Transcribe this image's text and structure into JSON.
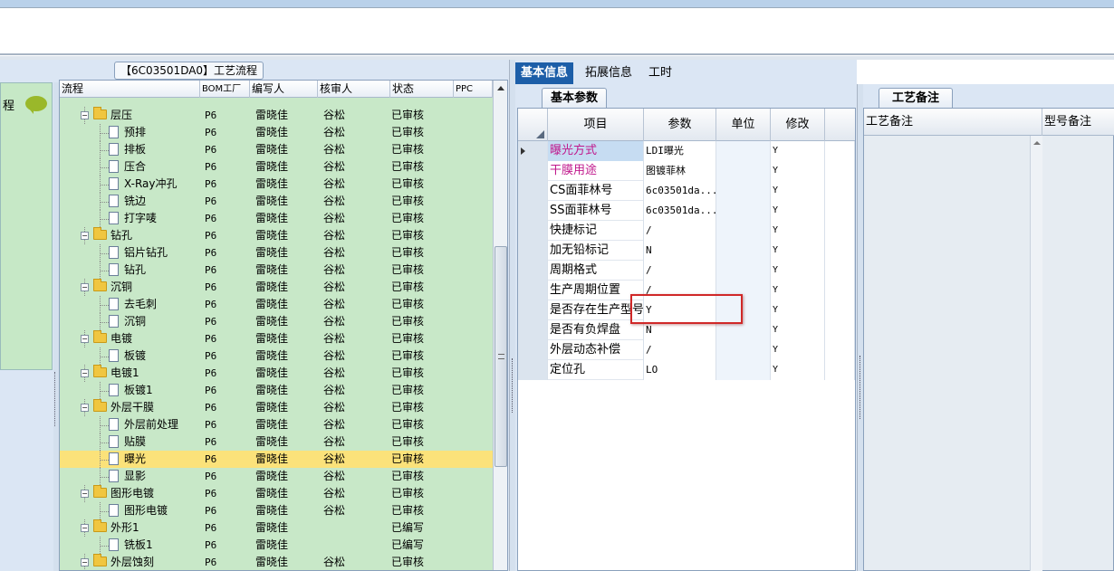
{
  "flow_panel": {
    "title": "【6C03501DA0】工艺流程",
    "side_label": "程",
    "headers": [
      "流程",
      "BOM工厂",
      "编写人",
      "核审人",
      "状态",
      "PPC"
    ],
    "rows": [
      {
        "name": "层压",
        "type": "folder",
        "bom": "P6",
        "writer": "雷晓佳",
        "reviewer": "谷松",
        "status": "已审核"
      },
      {
        "name": "预排",
        "type": "doc",
        "bom": "P6",
        "writer": "雷晓佳",
        "reviewer": "谷松",
        "status": "已审核"
      },
      {
        "name": "排板",
        "type": "doc",
        "bom": "P6",
        "writer": "雷晓佳",
        "reviewer": "谷松",
        "status": "已审核"
      },
      {
        "name": "压合",
        "type": "doc",
        "bom": "P6",
        "writer": "雷晓佳",
        "reviewer": "谷松",
        "status": "已审核"
      },
      {
        "name": "X-Ray冲孔",
        "type": "doc",
        "bom": "P6",
        "writer": "雷晓佳",
        "reviewer": "谷松",
        "status": "已审核"
      },
      {
        "name": "铣边",
        "type": "doc",
        "bom": "P6",
        "writer": "雷晓佳",
        "reviewer": "谷松",
        "status": "已审核"
      },
      {
        "name": "打字唛",
        "type": "doc",
        "bom": "P6",
        "writer": "雷晓佳",
        "reviewer": "谷松",
        "status": "已审核"
      },
      {
        "name": "钻孔",
        "type": "folder",
        "bom": "P6",
        "writer": "雷晓佳",
        "reviewer": "谷松",
        "status": "已审核"
      },
      {
        "name": "铝片钻孔",
        "type": "doc",
        "bom": "P6",
        "writer": "雷晓佳",
        "reviewer": "谷松",
        "status": "已审核"
      },
      {
        "name": "钻孔",
        "type": "doc",
        "bom": "P6",
        "writer": "雷晓佳",
        "reviewer": "谷松",
        "status": "已审核"
      },
      {
        "name": "沉铜",
        "type": "folder",
        "bom": "P6",
        "writer": "雷晓佳",
        "reviewer": "谷松",
        "status": "已审核"
      },
      {
        "name": "去毛刺",
        "type": "doc",
        "bom": "P6",
        "writer": "雷晓佳",
        "reviewer": "谷松",
        "status": "已审核"
      },
      {
        "name": "沉铜",
        "type": "doc",
        "bom": "P6",
        "writer": "雷晓佳",
        "reviewer": "谷松",
        "status": "已审核"
      },
      {
        "name": "电镀",
        "type": "folder",
        "bom": "P6",
        "writer": "雷晓佳",
        "reviewer": "谷松",
        "status": "已审核"
      },
      {
        "name": "板镀",
        "type": "doc",
        "bom": "P6",
        "writer": "雷晓佳",
        "reviewer": "谷松",
        "status": "已审核"
      },
      {
        "name": "电镀1",
        "type": "folder",
        "bom": "P6",
        "writer": "雷晓佳",
        "reviewer": "谷松",
        "status": "已审核"
      },
      {
        "name": "板镀1",
        "type": "doc",
        "bom": "P6",
        "writer": "雷晓佳",
        "reviewer": "谷松",
        "status": "已审核"
      },
      {
        "name": "外层干膜",
        "type": "folder",
        "bom": "P6",
        "writer": "雷晓佳",
        "reviewer": "谷松",
        "status": "已审核"
      },
      {
        "name": "外层前处理",
        "type": "doc",
        "bom": "P6",
        "writer": "雷晓佳",
        "reviewer": "谷松",
        "status": "已审核"
      },
      {
        "name": "贴膜",
        "type": "doc",
        "bom": "P6",
        "writer": "雷晓佳",
        "reviewer": "谷松",
        "status": "已审核"
      },
      {
        "name": "曝光",
        "type": "doc",
        "bom": "P6",
        "writer": "雷晓佳",
        "reviewer": "谷松",
        "status": "已审核",
        "selected": true
      },
      {
        "name": "显影",
        "type": "doc",
        "bom": "P6",
        "writer": "雷晓佳",
        "reviewer": "谷松",
        "status": "已审核"
      },
      {
        "name": "图形电镀",
        "type": "folder",
        "bom": "P6",
        "writer": "雷晓佳",
        "reviewer": "谷松",
        "status": "已审核"
      },
      {
        "name": "图形电镀",
        "type": "doc",
        "bom": "P6",
        "writer": "雷晓佳",
        "reviewer": "谷松",
        "status": "已审核"
      },
      {
        "name": "外形1",
        "type": "folder",
        "bom": "P6",
        "writer": "雷晓佳",
        "reviewer": "",
        "status": "已编写"
      },
      {
        "name": "铣板1",
        "type": "doc",
        "bom": "P6",
        "writer": "雷晓佳",
        "reviewer": "",
        "status": "已编写"
      },
      {
        "name": "外层蚀刻",
        "type": "folder",
        "bom": "P6",
        "writer": "雷晓佳",
        "reviewer": "谷松",
        "status": "已审核"
      }
    ]
  },
  "detail_tabs": [
    "基本信息",
    "拓展信息",
    "工时"
  ],
  "params": {
    "subtab": "基本参数",
    "headers": [
      "项目",
      "参数",
      "单位",
      "修改"
    ],
    "rows": [
      {
        "item": "曝光方式",
        "value": "LDI曝光",
        "unit": "",
        "mod": "Y",
        "item_color": "#c0188c"
      },
      {
        "item": "干膜用途",
        "value": "图镀菲林",
        "unit": "",
        "mod": "Y",
        "item_color": "#c0188c"
      },
      {
        "item": "CS面菲林号",
        "value": "6c03501da...",
        "unit": "",
        "mod": "Y"
      },
      {
        "item": "SS面菲林号",
        "value": "6c03501da...",
        "unit": "",
        "mod": "Y"
      },
      {
        "item": "快捷标记",
        "value": "/",
        "unit": "",
        "mod": "Y"
      },
      {
        "item": "加无铅标记",
        "value": "N",
        "unit": "",
        "mod": "Y"
      },
      {
        "item": "周期格式",
        "value": "/",
        "unit": "",
        "mod": "Y"
      },
      {
        "item": "生产周期位置",
        "value": "/",
        "unit": "",
        "mod": "Y"
      },
      {
        "item": "是否存在生产型号",
        "value": "Y",
        "unit": "",
        "mod": "Y"
      },
      {
        "item": "是否有负焊盘",
        "value": "N",
        "unit": "",
        "mod": "Y"
      },
      {
        "item": "外层动态补偿",
        "value": "/",
        "unit": "",
        "mod": "Y"
      },
      {
        "item": "定位孔",
        "value": "LO",
        "unit": "",
        "mod": "Y"
      }
    ]
  },
  "notes_panel": {
    "tab": "工艺备注",
    "headers": [
      "工艺备注",
      "型号备注"
    ]
  },
  "colors": {
    "accent": "#1c5ea8",
    "tree_bg": "#c8e8c8",
    "selected_row": "#fbe27a",
    "highlight_box": "#d02828"
  }
}
